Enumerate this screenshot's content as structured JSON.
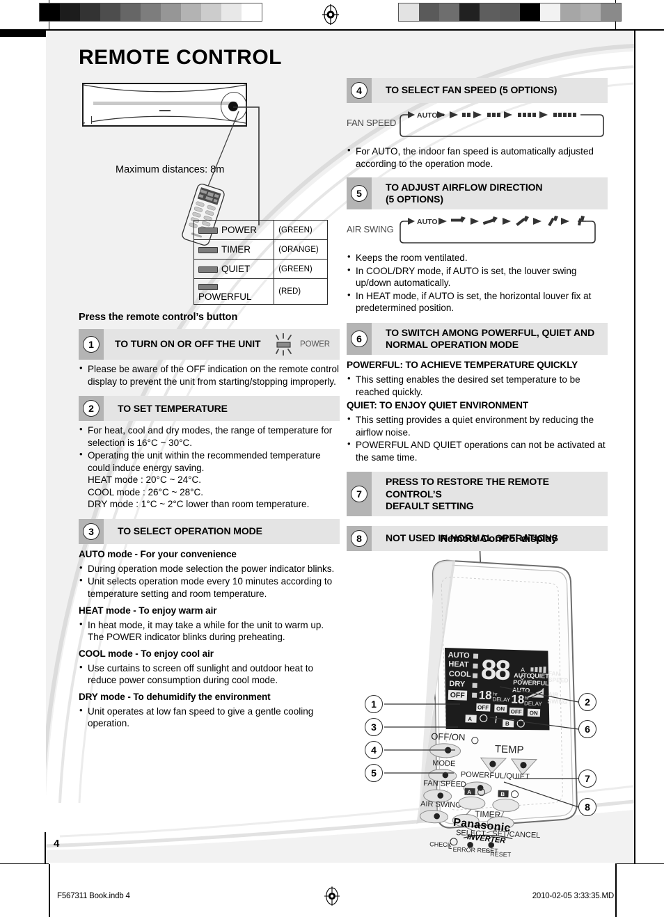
{
  "page": {
    "title": "REMOTE CONTROL",
    "number": "4"
  },
  "unit_diagram": {
    "max_distance_label": "Maximum distances: 8m"
  },
  "indicator_table": {
    "rows": [
      {
        "name": "POWER",
        "color": "(GREEN)",
        "lamp_icon": "lamp-icon"
      },
      {
        "name": "TIMER",
        "color": "(ORANGE)",
        "lamp_icon": "lamp-icon"
      },
      {
        "name": "QUIET",
        "color": "(GREEN)",
        "lamp_icon": "lamp-icon"
      },
      {
        "name": "POWERFUL",
        "color": "(RED)",
        "lamp_icon": "lamp-icon"
      }
    ]
  },
  "left_column": {
    "intro_heading": "Press the remote control’s button",
    "sections": [
      {
        "num": "1",
        "title": "TO TURN ON OR OFF THE UNIT",
        "icon_label": "POWER",
        "icon_name": "blinking-power-lamp-icon",
        "bullets": [
          "Please be aware of the OFF indication on the remote control display to prevent the unit from starting/stopping improperly."
        ]
      },
      {
        "num": "2",
        "title": "TO SET TEMPERATURE",
        "bullets": [
          "For heat, cool and dry modes, the range of temperature for selection is 16°C ~ 30°C.",
          "Operating the unit within the recommended temperature could induce energy saving."
        ],
        "sublines": [
          "HEAT mode : 20°C ~ 24°C.",
          "COOL mode : 26°C ~ 28°C.",
          "DRY mode : 1°C ~ 2°C lower than room temperature."
        ]
      },
      {
        "num": "3",
        "title": "TO SELECT OPERATION MODE",
        "modes": [
          {
            "heading": "AUTO mode - For your convenience",
            "bullets": [
              "During operation mode selection the power indicator blinks.",
              "Unit selects operation mode every 10 minutes according to temperature setting and room temperature."
            ]
          },
          {
            "heading": "HEAT mode - To enjoy warm air",
            "bullets": [
              "In heat mode, it may take a while for the unit to warm up. The POWER indicator blinks during preheating."
            ]
          },
          {
            "heading": "COOL mode - To enjoy cool air",
            "bullets": [
              "Use curtains to screen off sunlight and outdoor heat to reduce power consumption during cool mode."
            ]
          },
          {
            "heading": "DRY mode - To dehumidify the environment",
            "bullets": [
              "Unit operates at low fan speed to give a gentle cooling operation."
            ]
          }
        ]
      }
    ]
  },
  "right_column": {
    "sections": [
      {
        "num": "4",
        "title": "TO SELECT FAN SPEED (5 OPTIONS)",
        "flow": {
          "label": "FAN SPEED",
          "name": "fan-speed-flow-diagram",
          "first": "AUTO",
          "steps": [
            1,
            2,
            3,
            4,
            5
          ]
        },
        "bullets": [
          "For AUTO, the indoor fan speed is automatically adjusted according to the operation mode."
        ]
      },
      {
        "num": "5",
        "title_line1": "TO ADJUST AIRFLOW DIRECTION",
        "title_line2": "(5 OPTIONS)",
        "flow": {
          "label": "AIR SWING",
          "name": "air-swing-flow-diagram",
          "first": "AUTO",
          "steps": [
            1,
            2,
            3,
            4,
            5
          ]
        },
        "bullets": [
          "Keeps the room ventilated.",
          "In COOL/DRY mode, if AUTO is set, the louver swing up/down automatically.",
          "In HEAT mode, if AUTO is set, the horizontal louver fix at predetermined position."
        ]
      },
      {
        "num": "6",
        "title_line1": "TO SWITCH AMONG POWERFUL, QUIET AND",
        "title_line2": "NORMAL OPERATION MODE",
        "groups": [
          {
            "heading": "POWERFUL: TO ACHIEVE TEMPERATURE QUICKLY",
            "bullets": [
              "This setting enables the desired set temperature to be reached quickly."
            ]
          },
          {
            "heading": "QUIET: TO ENJOY QUIET ENVIRONMENT",
            "bullets": [
              "This setting provides a quiet environment by reducing the airflow noise.",
              "POWERFUL AND QUIET operations can not be activated at the same time."
            ]
          }
        ]
      },
      {
        "num": "7",
        "title_line1": "PRESS TO RESTORE THE REMOTE CONTROL’S",
        "title_line2": "DEFAULT SETTING"
      },
      {
        "num": "8",
        "title": "NOT USED IN NORMAL OPERATIONS"
      }
    ]
  },
  "remote_diagram": {
    "caption": "Remote Control display",
    "lcd": {
      "modes": [
        "AUTO",
        "HEAT",
        "COOL",
        "DRY"
      ],
      "off_badge": "OFF",
      "big_digits": "88",
      "unit_a": "A",
      "unit_c": "C",
      "timer_left_value": "18",
      "timer_left_unit": "hr",
      "timer_left_word": "DELAY",
      "timer_right_value": "18",
      "timer_right_unit": "hr",
      "timer_right_word": "DELAY",
      "badges_left": [
        "OFF",
        "ON"
      ],
      "badges_right": [
        "OFF",
        "ON"
      ],
      "right_labels": [
        "AUTO",
        "QUIET",
        "POWERFUL",
        "AUTO"
      ],
      "fan_speed_label": "FAN SPEED",
      "air_swing_label": "AIR SWING",
      "ab_left": "A",
      "ab_right": "B"
    },
    "buttons": [
      "OFF/ON",
      "TEMP",
      "MODE",
      "POWERFUL/QUIET",
      "FAN SPEED",
      "AIR SWING",
      "TIMER",
      "SELECT",
      "SET/CANCEL",
      "CHECK",
      "ERROR RESET",
      "RESET"
    ],
    "brand": "Panasonic",
    "subbrand": "INVERTER",
    "callouts_left": [
      "1",
      "3",
      "4",
      "5"
    ],
    "callouts_right": [
      "2",
      "6",
      "7",
      "8"
    ]
  },
  "footer": {
    "left": "F567311 Book.indb   4",
    "right": "2010-02-05   3:33:35.MD"
  },
  "colors": {
    "section_num_bg": "#b4b4b4",
    "section_title_bg": "#e4e4e4",
    "lamp": "#7d7d7d",
    "ink": "#000000"
  },
  "calibration": {
    "left_patches": [
      "#000000",
      "#1c1c1c",
      "#333333",
      "#4d4d4d",
      "#666666",
      "#7d7d7d",
      "#969696",
      "#b3b3b3",
      "#cccccc",
      "#e8e8e8",
      "#ffffff"
    ],
    "right_patches": [
      "#e3e3e3",
      "#5a5a5a",
      "#6e6e6e",
      "#212121",
      "#5e5e5e",
      "#5a5a5a",
      "#000000",
      "#f2f2f2",
      "#a6a6a6",
      "#b0b0b0",
      "#8a8a8a"
    ]
  }
}
